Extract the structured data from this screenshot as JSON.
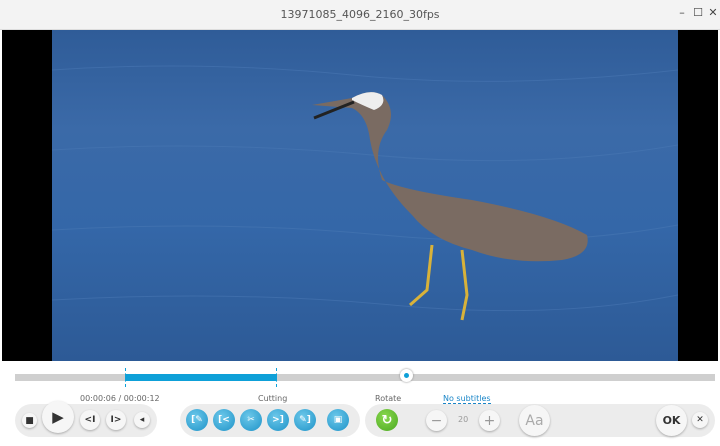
{
  "window": {
    "title": "13971085_4096_2160_30fps",
    "minimize": "–",
    "maximize": "☐",
    "close": "✕"
  },
  "player": {
    "time": "00:00:06 / 00:00:12",
    "progress_fraction": 0.5,
    "stop_icon": "■",
    "play_icon": "▶",
    "prev_frame": "<I",
    "next_frame": "I>",
    "volume_icon": "◂"
  },
  "cutting": {
    "label": "Cutting",
    "buttons": [
      {
        "icon": "mark-in-icon",
        "glyph": "[✎"
      },
      {
        "icon": "go-start-icon",
        "glyph": "[<"
      },
      {
        "icon": "scissors-icon",
        "glyph": "✂"
      },
      {
        "icon": "go-end-icon",
        "glyph": ">]"
      },
      {
        "icon": "mark-out-icon",
        "glyph": "✎]"
      },
      {
        "icon": "preview-icon",
        "glyph": "▣"
      }
    ]
  },
  "rotate": {
    "label": "Rotate",
    "icon": "↻"
  },
  "subtitles": {
    "label": "No subtitles",
    "minus": "−",
    "size": "20",
    "plus": "+",
    "font_button": "Aa"
  },
  "actions": {
    "ok": "OK",
    "cancel": "✕"
  },
  "colors": {
    "accent": "#0ea0d8",
    "rotate": "#5cb82e"
  }
}
